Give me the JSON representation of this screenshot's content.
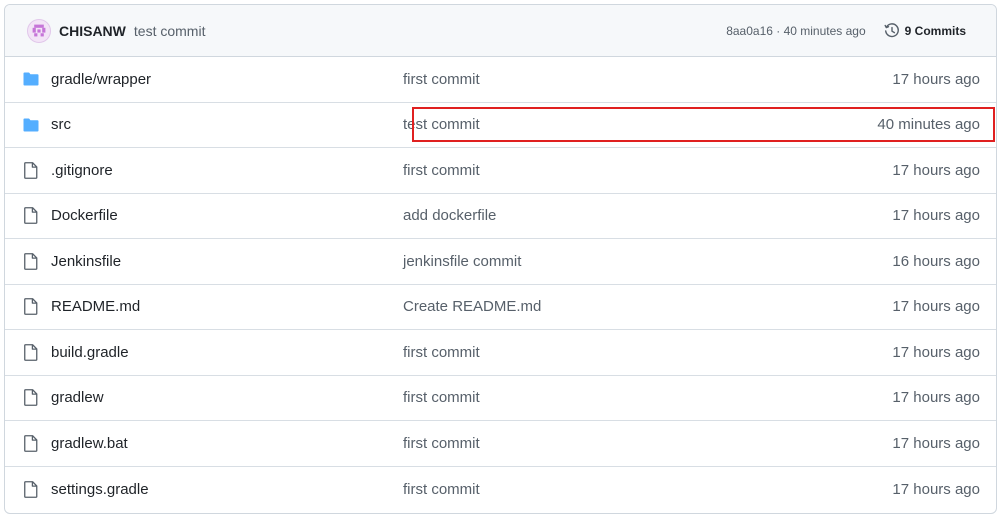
{
  "header": {
    "author": "CHISANW",
    "message": "test commit",
    "sha_time": "8aa0a16 · 40 minutes ago",
    "commits_label": "9 Commits",
    "avatar_icon": "identicon-avatar",
    "history_icon": "history-clock-icon"
  },
  "colors": {
    "folder": "#54aeff",
    "highlight": "#e02020",
    "header_bg": "#f6f8fa",
    "border": "#d0d7de"
  },
  "files": [
    {
      "type": "folder",
      "icon": "folder-icon",
      "name": "gradle/wrapper",
      "message": "first commit",
      "age": "17 hours ago"
    },
    {
      "type": "folder",
      "icon": "folder-icon",
      "name": "src",
      "message": "test commit",
      "age": "40 minutes ago",
      "highlighted": true
    },
    {
      "type": "file",
      "icon": "file-icon",
      "name": ".gitignore",
      "message": "first commit",
      "age": "17 hours ago"
    },
    {
      "type": "file",
      "icon": "file-icon",
      "name": "Dockerfile",
      "message": "add dockerfile",
      "age": "17 hours ago"
    },
    {
      "type": "file",
      "icon": "file-icon",
      "name": "Jenkinsfile",
      "message": "jenkinsfile commit",
      "age": "16 hours ago"
    },
    {
      "type": "file",
      "icon": "file-icon",
      "name": "README.md",
      "message": "Create README.md",
      "age": "17 hours ago"
    },
    {
      "type": "file",
      "icon": "file-icon",
      "name": "build.gradle",
      "message": "first commit",
      "age": "17 hours ago"
    },
    {
      "type": "file",
      "icon": "file-icon",
      "name": "gradlew",
      "message": "first commit",
      "age": "17 hours ago"
    },
    {
      "type": "file",
      "icon": "file-icon",
      "name": "gradlew.bat",
      "message": "first commit",
      "age": "17 hours ago"
    },
    {
      "type": "file",
      "icon": "file-icon",
      "name": "settings.gradle",
      "message": "first commit",
      "age": "17 hours ago"
    }
  ]
}
